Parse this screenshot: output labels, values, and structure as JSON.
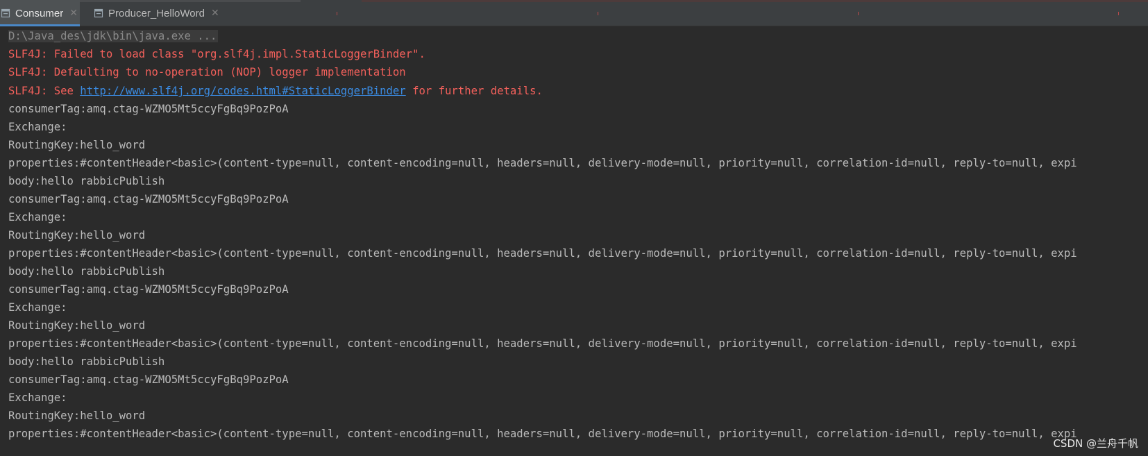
{
  "tabs": [
    {
      "label": "Consumer",
      "active": true,
      "icon": "run-config-icon"
    },
    {
      "label": "Producer_HelloWord",
      "active": false,
      "icon": "run-config-icon"
    }
  ],
  "console": {
    "command": "D:\\Java_des\\jdk\\bin\\java.exe ...",
    "slf4j": {
      "line1": "SLF4J: Failed to load class \"org.slf4j.impl.StaticLoggerBinder\".",
      "line2": "SLF4J: Defaulting to no-operation (NOP) logger implementation",
      "line3_prefix": "SLF4J: See ",
      "line3_link": "http://www.slf4j.org/codes.html#StaticLoggerBinder",
      "line3_suffix": " for further details."
    },
    "messages": [
      {
        "consumer_tag": "consumerTag:amq.ctag-WZMO5Mt5ccyFgBq9PozPoA",
        "exchange": "Exchange:",
        "routing_key": "RoutingKey:hello_word",
        "properties": "properties:#contentHeader<basic>(content-type=null, content-encoding=null, headers=null, delivery-mode=null, priority=null, correlation-id=null, reply-to=null, expi",
        "body": "body:hello rabbicPublish"
      },
      {
        "consumer_tag": "consumerTag:amq.ctag-WZMO5Mt5ccyFgBq9PozPoA",
        "exchange": "Exchange:",
        "routing_key": "RoutingKey:hello_word",
        "properties": "properties:#contentHeader<basic>(content-type=null, content-encoding=null, headers=null, delivery-mode=null, priority=null, correlation-id=null, reply-to=null, expi",
        "body": "body:hello rabbicPublish"
      },
      {
        "consumer_tag": "consumerTag:amq.ctag-WZMO5Mt5ccyFgBq9PozPoA",
        "exchange": "Exchange:",
        "routing_key": "RoutingKey:hello_word",
        "properties": "properties:#contentHeader<basic>(content-type=null, content-encoding=null, headers=null, delivery-mode=null, priority=null, correlation-id=null, reply-to=null, expi",
        "body": "body:hello rabbicPublish"
      },
      {
        "consumer_tag": "consumerTag:amq.ctag-WZMO5Mt5ccyFgBq9PozPoA",
        "exchange": "Exchange:",
        "routing_key": "RoutingKey:hello_word",
        "properties": "properties:#contentHeader<basic>(content-type=null, content-encoding=null, headers=null, delivery-mode=null, priority=null, correlation-id=null, reply-to=null, expi"
      }
    ]
  },
  "watermark": "CSDN @兰舟千帆",
  "colors": {
    "background": "#2b2b2b",
    "text": "#bbbbbb",
    "error": "#f2605b",
    "link": "#3a8ae0",
    "tab_accent": "#4a88c7"
  }
}
